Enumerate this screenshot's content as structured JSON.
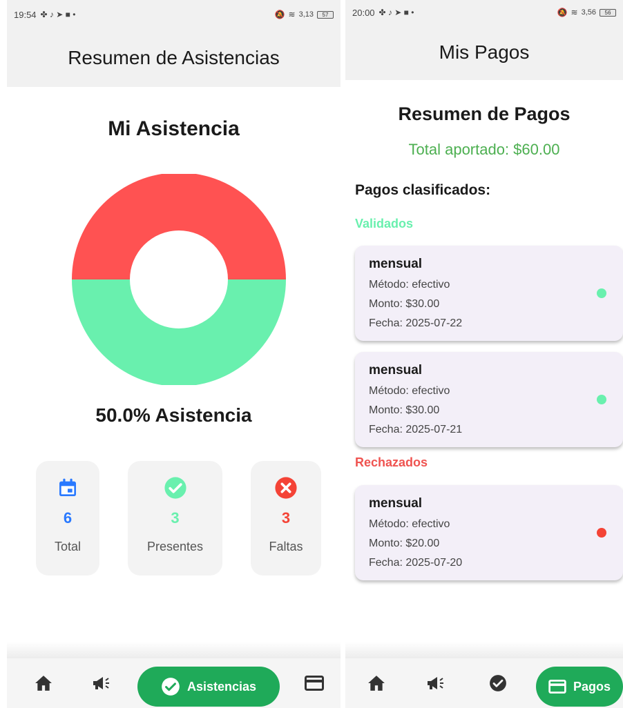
{
  "left": {
    "status": {
      "time": "19:54",
      "signal": "3,13",
      "battery": "57"
    },
    "app_title": "Resumen de Asistencias",
    "heading": "Mi Asistencia",
    "chart_data": {
      "type": "pie",
      "variant": "donut",
      "slices": [
        {
          "label": "Faltas",
          "value": 3,
          "color": "#ff5252"
        },
        {
          "label": "Presentes",
          "value": 3,
          "color": "#69f0ae"
        }
      ]
    },
    "percent_text": "50.0% Asistencia",
    "stats": [
      {
        "value": "6",
        "label": "Total",
        "color": "#2979ff",
        "icon": "calendar-icon"
      },
      {
        "value": "3",
        "label": "Presentes",
        "color": "#69f0ae",
        "icon": "check-circle-icon"
      },
      {
        "value": "3",
        "label": "Faltas",
        "color": "#f44336",
        "icon": "cancel-circle-icon"
      }
    ],
    "nav": {
      "active_label": "Asistencias",
      "accent": "#1faa59"
    }
  },
  "right": {
    "status": {
      "time": "20:00",
      "signal": "3,56",
      "battery": "56"
    },
    "app_title": "Mis Pagos",
    "summary_title": "Resumen de Pagos",
    "total_text": "Total aportado: $60.00",
    "classified_title": "Pagos clasificados:",
    "groups": {
      "validated": {
        "title": "Validados",
        "color": "#69f0ae"
      },
      "rejected": {
        "title": "Rechazados",
        "color": "#ef5350"
      }
    },
    "payments": [
      {
        "title": "mensual",
        "method": "Método: efectivo",
        "amount": "Monto: $30.00",
        "date": "Fecha: 2025-07-22",
        "status_color": "#69f0ae"
      },
      {
        "title": "mensual",
        "method": "Método: efectivo",
        "amount": "Monto: $30.00",
        "date": "Fecha: 2025-07-21",
        "status_color": "#69f0ae"
      },
      {
        "title": "mensual",
        "method": "Método: efectivo",
        "amount": "Monto: $20.00",
        "date": "Fecha: 2025-07-20",
        "status_color": "#f44336"
      }
    ],
    "nav": {
      "active_label": "Pagos",
      "accent": "#1faa59"
    }
  }
}
